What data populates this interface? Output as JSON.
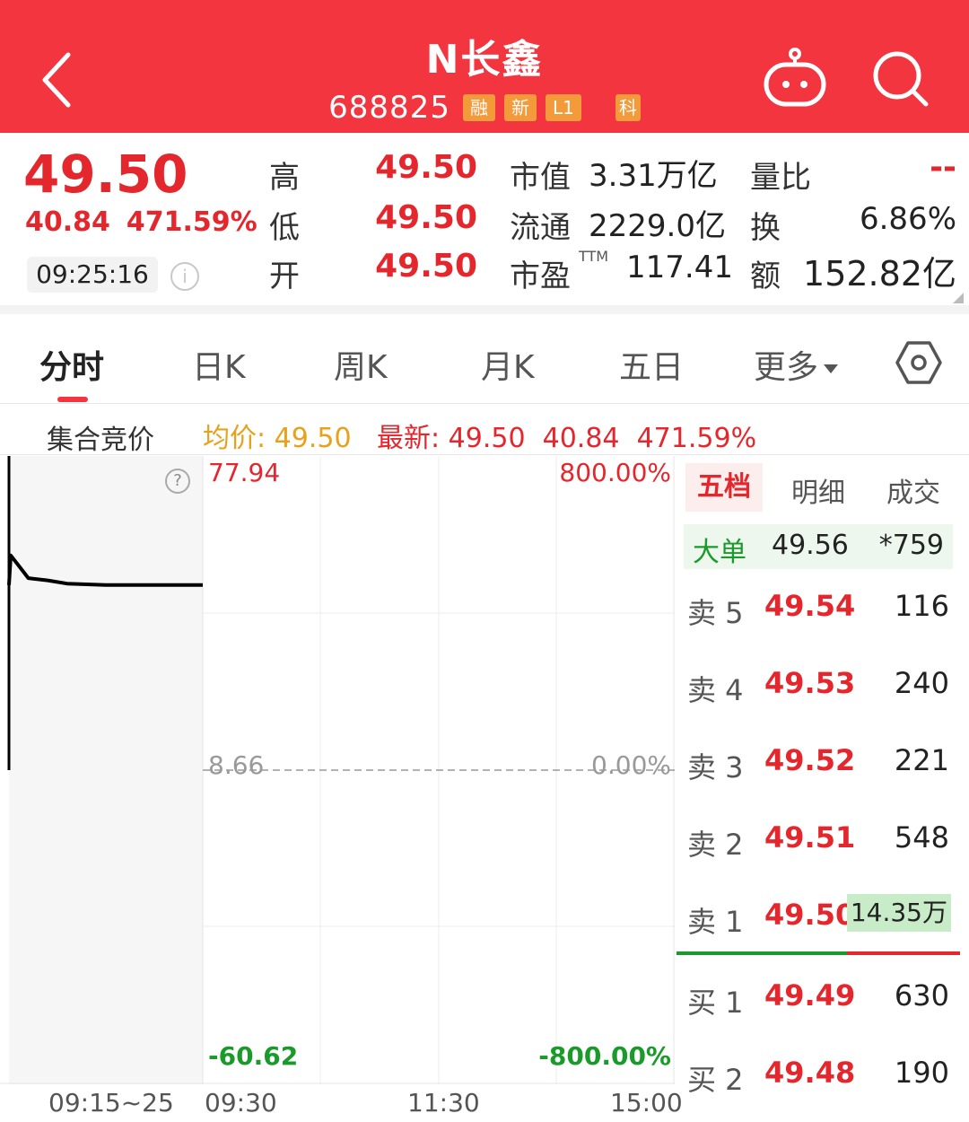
{
  "header": {
    "stock_name": "N长鑫",
    "stock_code": "688825",
    "tags": [
      "融",
      "新",
      "L1",
      "科"
    ],
    "bg_color": "#f2353f"
  },
  "quote": {
    "price": "49.50",
    "change": "40.84",
    "change_pct": "471.59%",
    "time": "09:25:16",
    "high_label": "高",
    "high": "49.50",
    "low_label": "低",
    "low": "49.50",
    "open_label": "开",
    "open": "49.50",
    "mktcap_label": "市值",
    "mktcap": "3.31万亿",
    "float_label": "流通",
    "float": "2229.0亿",
    "pe_label": "市盈",
    "pe_sup": "TTM",
    "pe": "117.41",
    "vol_ratio_label": "量比",
    "vol_ratio": "--",
    "turnover_label": "换",
    "turnover": "6.86%",
    "amount_label": "额",
    "amount": "152.82亿"
  },
  "tabs": [
    {
      "label": "分时",
      "active": true
    },
    {
      "label": "日K"
    },
    {
      "label": "周K"
    },
    {
      "label": "月K"
    },
    {
      "label": "五日"
    },
    {
      "label": "更多"
    }
  ],
  "info_line": {
    "auction": "集合竞价",
    "avg_label": "均价:",
    "avg": "49.50",
    "latest_label": "最新:",
    "latest": "49.50",
    "change": "40.84",
    "change_pct": "471.59%"
  },
  "chart": {
    "y_top": "77.94",
    "y_mid": "8.66",
    "y_bottom": "-60.62",
    "pct_top": "800.00%",
    "pct_mid": "0.00%",
    "pct_bottom": "-800.00%",
    "x_labels": [
      "09:15~25",
      "09:30",
      "11:30",
      "15:00"
    ]
  },
  "chart_data": {
    "type": "line",
    "title": "",
    "xlabel": "",
    "ylabel": "",
    "ylim": [
      -60.62,
      77.94
    ],
    "y2lim": [
      -800.0,
      800.0
    ],
    "series": [
      {
        "x": [
          "09:15",
          "09:15",
          "09:16",
          "09:17",
          "09:18",
          "09:20",
          "09:25"
        ],
        "values": [
          49.5,
          56.0,
          51.0,
          50.5,
          49.8,
          49.5,
          49.5
        ]
      }
    ],
    "reference_line": 8.66
  },
  "book": {
    "tabs": [
      {
        "label": "五档",
        "active": true
      },
      {
        "label": "明细"
      },
      {
        "label": "成交"
      }
    ],
    "big_order": {
      "label": "大单",
      "price": "49.56",
      "volume": "*759"
    },
    "asks": [
      {
        "label": "卖 5",
        "price": "49.54",
        "volume": "116"
      },
      {
        "label": "卖 4",
        "price": "49.53",
        "volume": "240"
      },
      {
        "label": "卖 3",
        "price": "49.52",
        "volume": "221"
      },
      {
        "label": "卖 2",
        "price": "49.51",
        "volume": "548"
      },
      {
        "label": "卖 1",
        "price": "49.50",
        "volume": "14.35万"
      }
    ],
    "bids": [
      {
        "label": "买 1",
        "price": "49.49",
        "volume": "630"
      },
      {
        "label": "买 2",
        "price": "49.48",
        "volume": "190"
      }
    ]
  }
}
